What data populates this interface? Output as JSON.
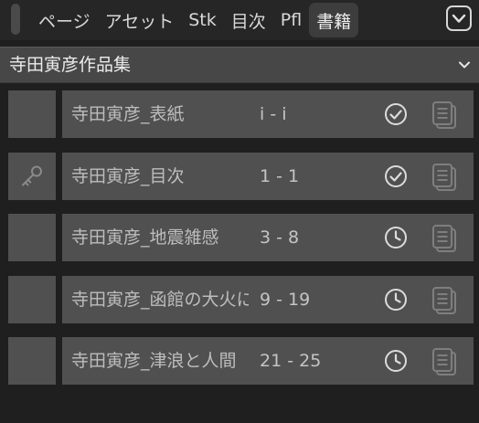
{
  "tabs": [
    {
      "label": "ページ",
      "active": false
    },
    {
      "label": "アセット",
      "active": false
    },
    {
      "label": "Stk",
      "active": false
    },
    {
      "label": "目次",
      "active": false
    },
    {
      "label": "Pfl",
      "active": false
    },
    {
      "label": "書籍",
      "active": true
    }
  ],
  "topbar": {
    "expand_icon": "chevron-down-box-icon"
  },
  "selector": {
    "value": "寺田寅彦作品集",
    "icon": "chevron-down-icon"
  },
  "rows": [
    {
      "title": "寺田寅彦_表紙",
      "pages": "i - i",
      "status": "done",
      "status_icon": "check-circle-icon",
      "lead_icon": "",
      "doc_icon": "document-stack-icon"
    },
    {
      "title": "寺田寅彦_目次",
      "pages": "1 - 1",
      "status": "done",
      "status_icon": "check-circle-icon",
      "lead_icon": "key-icon",
      "doc_icon": "document-stack-icon"
    },
    {
      "title": "寺田寅彦_地震雑感",
      "pages": "3 - 8",
      "status": "pending",
      "status_icon": "clock-icon",
      "lead_icon": "",
      "doc_icon": "document-stack-icon"
    },
    {
      "title": "寺田寅彦_函館の大火について",
      "pages": "9 - 19",
      "status": "pending",
      "status_icon": "clock-icon",
      "lead_icon": "",
      "doc_icon": "document-stack-icon"
    },
    {
      "title": "寺田寅彦_津浪と人間",
      "pages": "21 - 25",
      "status": "pending",
      "status_icon": "clock-icon",
      "lead_icon": "",
      "doc_icon": "document-stack-icon"
    }
  ],
  "colors": {
    "background": "#1f1f1f",
    "topbar": "#262626",
    "tab_active": "#3d3d3d",
    "selector": "#474747",
    "row": "#505050",
    "text": "#bdbdbd",
    "icon": "#d9d9d9",
    "icon_muted": "#7c7c7c"
  }
}
